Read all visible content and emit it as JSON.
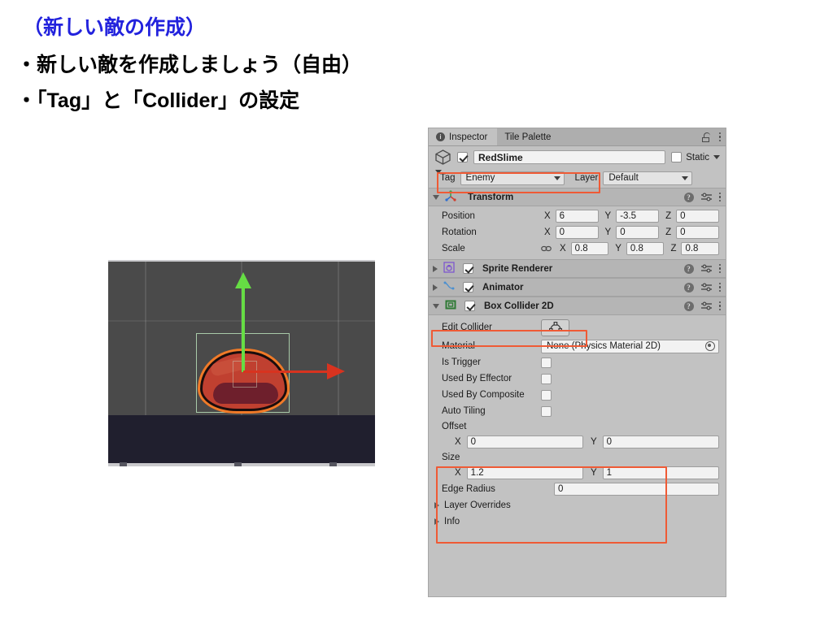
{
  "slide": {
    "title": "（新しい敵の作成）",
    "bullets": [
      "・新しい敵を作成しましょう（自由）",
      "・「Tag」と「Collider」の設定"
    ],
    "title_color": "#2222dd"
  },
  "scene": {
    "name": "scene-view",
    "background_color": "#4a4a4a",
    "ground_color": "#201f2e",
    "gizmo_up_color": "#66dd44",
    "gizmo_right_color": "#d8331f",
    "collider_outline_color": "#a8c9a8",
    "sprite_name": "red-slime-sprite",
    "sprite_colors": {
      "body": "#c04030",
      "outline": "#f07a28",
      "dark_outline": "#1a0d0d",
      "shadow": "#6e1f2c"
    }
  },
  "inspector": {
    "tabs": [
      {
        "label": "Inspector",
        "icon": "info-icon",
        "active": true
      },
      {
        "label": "Tile Palette",
        "icon": "",
        "active": false
      }
    ],
    "lock_icon": "lock-icon",
    "menu_icon": "kebab-menu-icon",
    "object": {
      "enabled": true,
      "name": "RedSlime",
      "icon": "cube-icon",
      "static_label": "Static",
      "static_checked": false,
      "tag_label": "Tag",
      "tag_value": "Enemy",
      "layer_label": "Layer",
      "layer_value": "Default"
    },
    "components": [
      {
        "name": "Transform",
        "icon": "transform-axis-icon",
        "expanded": true,
        "rows": [
          {
            "label": "Position",
            "x": "6",
            "y": "-3.5",
            "z": "0"
          },
          {
            "label": "Rotation",
            "x": "0",
            "y": "0",
            "z": "0"
          },
          {
            "label": "Scale",
            "x": "0.8",
            "y": "0.8",
            "z": "0.8",
            "linked": true
          }
        ]
      },
      {
        "name": "Sprite Renderer",
        "icon": "sprite-renderer-icon",
        "expanded": false,
        "enabled": true
      },
      {
        "name": "Animator",
        "icon": "animator-icon",
        "expanded": false,
        "enabled": true
      },
      {
        "name": "Box Collider 2D",
        "icon": "box-collider-2d-icon",
        "expanded": true,
        "enabled": true
      }
    ],
    "box_collider": {
      "edit_collider_label": "Edit Collider",
      "edit_collider_button_icon": "edit-collider-icon",
      "material_label": "Material",
      "material_value": "None (Physics Material 2D)",
      "material_picker_icon": "object-picker-icon",
      "toggles": [
        {
          "label": "Is Trigger",
          "checked": false
        },
        {
          "label": "Used By Effector",
          "checked": false
        },
        {
          "label": "Used By Composite",
          "checked": false
        },
        {
          "label": "Auto Tiling",
          "checked": false
        }
      ],
      "offset_label": "Offset",
      "offset_x_axis": "X",
      "offset_x": "0",
      "offset_y_axis": "Y",
      "offset_y": "0",
      "size_label": "Size",
      "size_x_axis": "X",
      "size_x": "1.2",
      "size_y_axis": "Y",
      "size_y": "1",
      "edge_radius_label": "Edge Radius",
      "edge_radius": "0",
      "layer_overrides_label": "Layer Overrides",
      "info_label": "Info"
    },
    "help_icon_char": "?",
    "highlight_color": "#ef5a35"
  }
}
